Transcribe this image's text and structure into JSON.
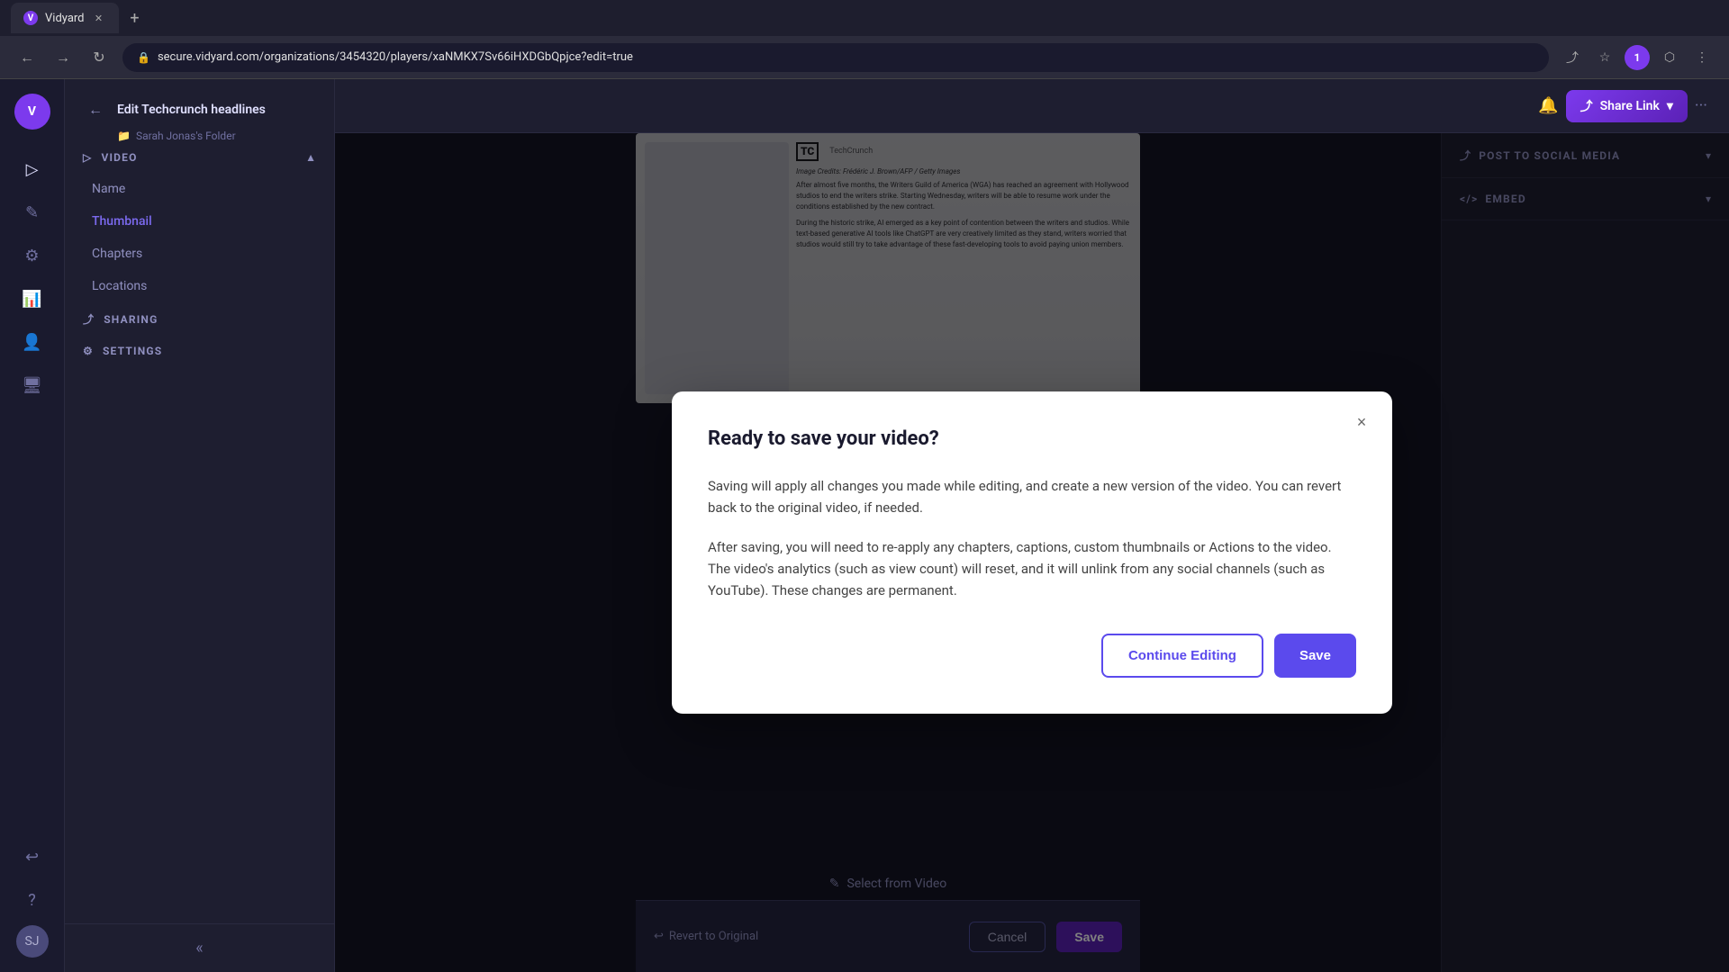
{
  "browser": {
    "tab_label": "Vidyard",
    "url": "secure.vidyard.com/organizations/3454320/players/xaNMKX7Sv66iHXDGbQpjce?edit=true",
    "new_tab_label": "+"
  },
  "app": {
    "logo_text": "V",
    "header": {
      "back_label": "←",
      "page_title": "Edit Techcrunch headlines",
      "folder_name": "Sarah Jonas's Folder",
      "share_link_label": "Share Link",
      "bell_label": "🔔",
      "more_label": "···"
    },
    "sidebar": {
      "items": [
        {
          "label": "▷",
          "name": "play-icon"
        },
        {
          "label": "✎",
          "name": "edit-icon"
        },
        {
          "label": "⚙",
          "name": "settings-icon"
        },
        {
          "label": "📊",
          "name": "analytics-icon"
        },
        {
          "label": "👤",
          "name": "user-icon"
        },
        {
          "label": "🖥",
          "name": "display-icon"
        }
      ],
      "bottom_items": [
        {
          "label": "↩",
          "name": "back-icon"
        },
        {
          "label": "?",
          "name": "help-icon"
        }
      ],
      "avatar_initials": "SJ"
    },
    "left_panel": {
      "sections": [
        {
          "id": "video",
          "title": "VIDEO",
          "icon": "▷",
          "items": [
            {
              "label": "Name",
              "active": false
            },
            {
              "label": "Thumbnail",
              "active": true
            },
            {
              "label": "Chapters",
              "active": false
            },
            {
              "label": "Locations",
              "active": false
            }
          ]
        },
        {
          "id": "sharing",
          "title": "SHARING",
          "icon": "⤴"
        },
        {
          "id": "settings",
          "title": "SETTINGS",
          "icon": "⚙"
        }
      ]
    },
    "right_panel": {
      "sections": [
        {
          "title": "POST TO SOCIAL MEDIA",
          "icon": "⤴"
        },
        {
          "title": "EMBED",
          "icon": "</>"
        }
      ]
    },
    "bottom_toolbar": {
      "revert_label": "Revert to Original",
      "cancel_label": "Cancel",
      "save_label": "Save"
    },
    "select_from_video_label": "Select from Video"
  },
  "modal": {
    "title": "Ready to save your video?",
    "paragraph1": "Saving will apply all changes you made while editing, and create a new version of the video. You can revert back to the original video, if needed.",
    "paragraph2": "After saving, you will need to re-apply any chapters, captions, custom thumbnails or Actions to the video. The video's analytics (such as view count) will reset, and it will unlink from any social channels (such as YouTube). These changes are permanent.",
    "continue_editing_label": "Continue Editing",
    "save_label": "Save",
    "close_label": "×"
  }
}
